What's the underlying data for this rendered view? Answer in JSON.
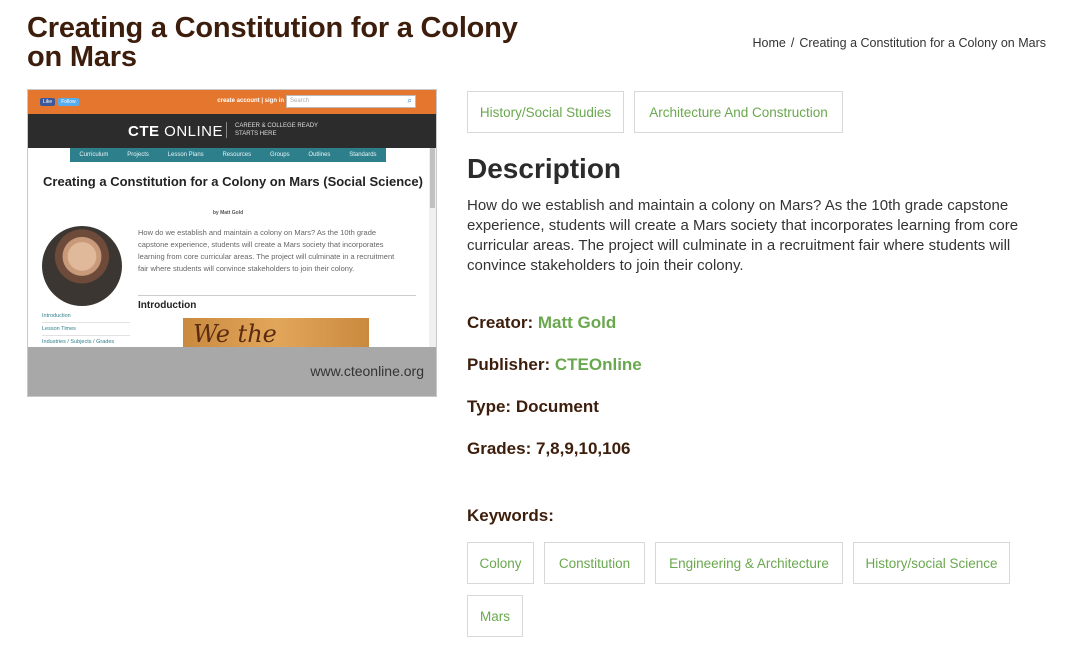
{
  "title": "Creating a Constitution for a Colony on Mars",
  "breadcrumb": {
    "home": "Home",
    "separator": "/",
    "current": "Creating a Constitution for a Colony on Mars"
  },
  "thumbnail": {
    "site_overlay": "www.cteonline.org",
    "social": [
      "Like",
      "Follow"
    ],
    "account_links": "create account | sign in",
    "search_placeholder": "Search",
    "brand": "CTE ONLINE",
    "brand_bold": "CTE",
    "brand_light": "ONLINE",
    "tagline": "CAREER & COLLEGE READY STARTS HERE",
    "nav": [
      "Curriculum",
      "Projects",
      "Lesson Plans",
      "Resources",
      "Groups",
      "Outlines",
      "Standards"
    ],
    "page_title": "Creating a Constitution for a Colony on Mars (Social Science)",
    "byline": "by Matt Gold",
    "blurb": "How do we establish and maintain a colony on Mars? As the 10th grade capstone experience, students will create a Mars society that incorporates learning from core curricular areas. The project will culminate in a recruitment fair where students will convince stakeholders to join their colony.",
    "intro_heading": "Introduction",
    "side_links": [
      "Introduction",
      "Lesson Times",
      "Industries / Subjects / Grades"
    ],
    "doc_image_text": "We the People"
  },
  "subject_tags": [
    "History/Social Studies",
    "Architecture And Construction"
  ],
  "description": {
    "heading": "Description",
    "text": "How do we establish and maintain a colony on Mars? As the 10th grade capstone experience, students will create a Mars society that incorporates learning from core curricular areas. The project will culminate in a recruitment fair where students will convince stakeholders to join their colony."
  },
  "meta": {
    "creator_label": "Creator:",
    "creator": "Matt Gold",
    "publisher_label": "Publisher:",
    "publisher": "CTEOnline",
    "type_label": "Type:",
    "type": "Document",
    "grades_label": "Grades:",
    "grades": "7,8,9,10,106"
  },
  "keywords": {
    "label": "Keywords:",
    "items": [
      "Colony",
      "Constitution",
      "Engineering & Architecture",
      "History/social Science",
      "Mars"
    ]
  },
  "colors": {
    "title": "#3d1e0c",
    "link_green": "#6aa84f",
    "thumb_orange": "#e5762e",
    "thumb_nav": "#2e7f8c"
  }
}
